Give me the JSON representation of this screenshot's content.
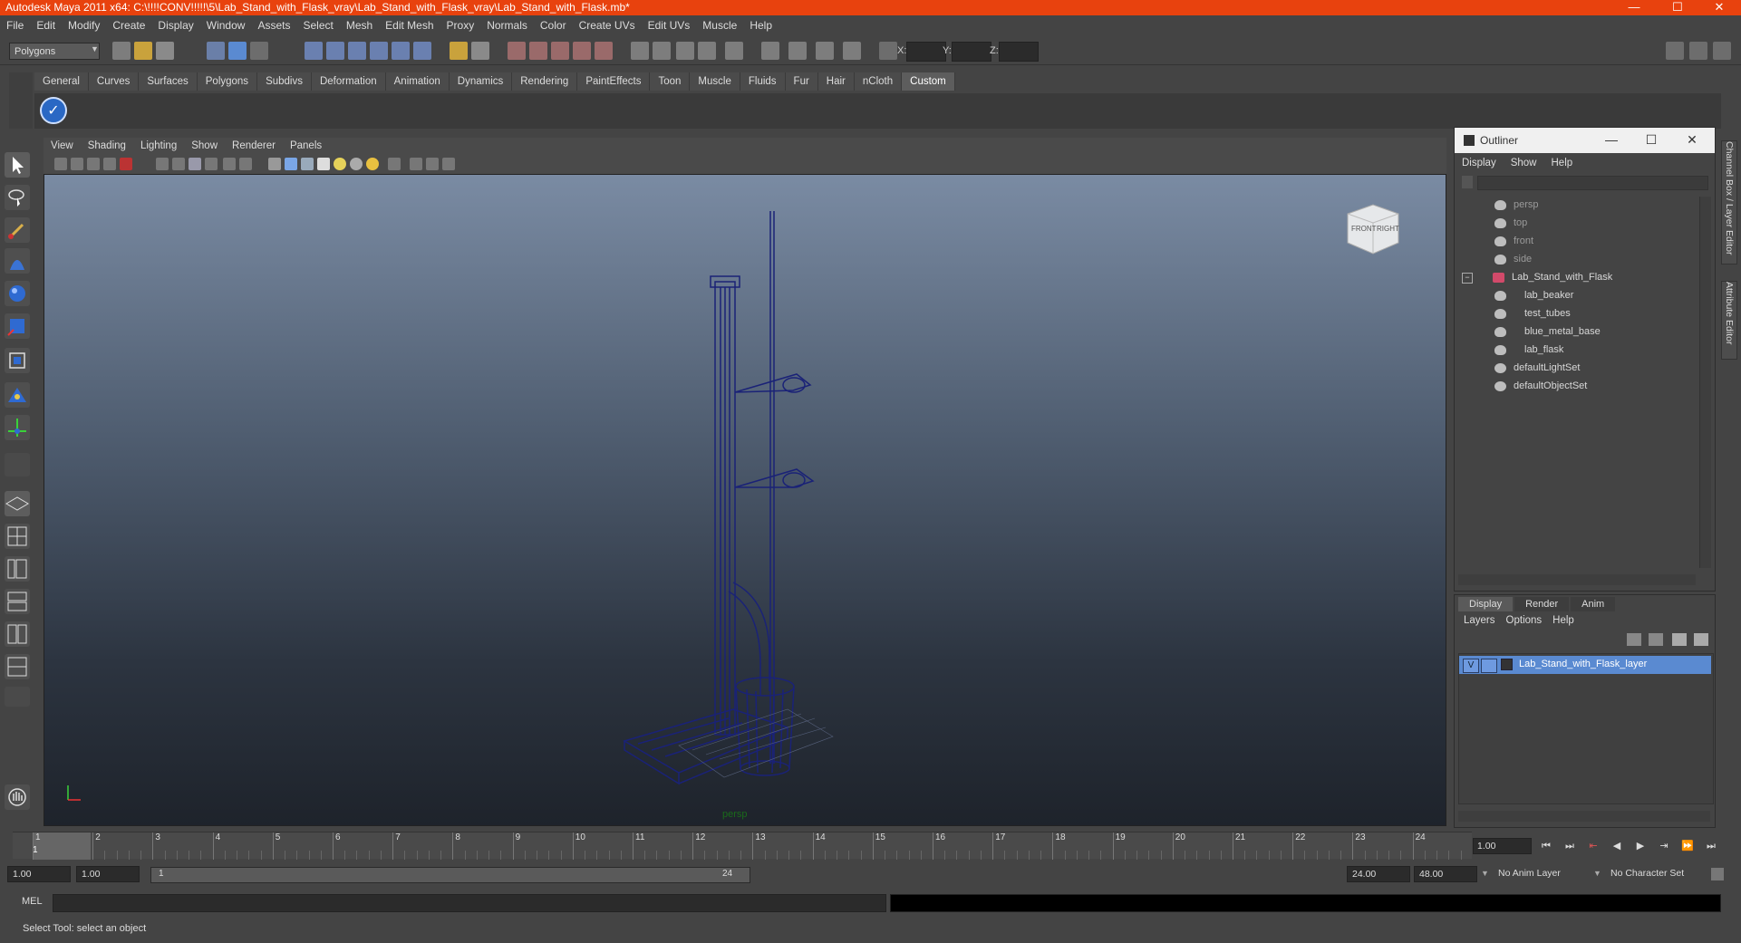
{
  "window": {
    "title": "Autodesk Maya 2011 x64: C:\\!!!!CONV!!!!!\\5\\Lab_Stand_with_Flask_vray\\Lab_Stand_with_Flask_vray\\Lab_Stand_with_Flask.mb*",
    "minimize": "—",
    "maximize": "☐",
    "close": "✕",
    "bar_color": "#e8420e"
  },
  "menubar": [
    "File",
    "Edit",
    "Modify",
    "Create",
    "Display",
    "Window",
    "Assets",
    "Select",
    "Mesh",
    "Edit Mesh",
    "Proxy",
    "Normals",
    "Color",
    "Create UVs",
    "Edit UVs",
    "Muscle",
    "Help"
  ],
  "statusline": {
    "mode": "Polygons",
    "coord_x_label": "X:",
    "coord_y_label": "Y:",
    "coord_z_label": "Z:"
  },
  "shelf": {
    "tabs": [
      "General",
      "Curves",
      "Surfaces",
      "Polygons",
      "Subdivs",
      "Deformation",
      "Animation",
      "Dynamics",
      "Rendering",
      "PaintEffects",
      "Toon",
      "Muscle",
      "Fluids",
      "Fur",
      "Hair",
      "nCloth",
      "Custom"
    ],
    "active_tab": "Custom"
  },
  "panel": {
    "menus": [
      "View",
      "Shading",
      "Lighting",
      "Show",
      "Renderer",
      "Panels"
    ],
    "camera_label": "persp",
    "viewcube_front": "FRONT",
    "viewcube_right": "RIGHT",
    "wire_color": "#1a2277"
  },
  "outliner": {
    "title": "Outliner",
    "menus": [
      "Display",
      "Show",
      "Help"
    ],
    "items": [
      {
        "label": "persp",
        "dim": true,
        "indent": 0
      },
      {
        "label": "top",
        "dim": true,
        "indent": 0
      },
      {
        "label": "front",
        "dim": true,
        "indent": 0
      },
      {
        "label": "side",
        "dim": true,
        "indent": 0
      },
      {
        "label": "Lab_Stand_with_Flask",
        "dim": false,
        "indent": 0
      },
      {
        "label": "lab_beaker",
        "dim": false,
        "indent": 1
      },
      {
        "label": "test_tubes",
        "dim": false,
        "indent": 1
      },
      {
        "label": "blue_metal_base",
        "dim": false,
        "indent": 1
      },
      {
        "label": "lab_flask",
        "dim": false,
        "indent": 1
      },
      {
        "label": "defaultLightSet",
        "dim": false,
        "indent": 0
      },
      {
        "label": "defaultObjectSet",
        "dim": false,
        "indent": 0
      }
    ],
    "collapse_symbol": "−"
  },
  "layers": {
    "tabs": [
      "Display",
      "Render",
      "Anim"
    ],
    "active_tab": "Display",
    "menus": [
      "Layers",
      "Options",
      "Help"
    ],
    "layer_name": "Lab_Stand_with_Flask_layer",
    "visibility": "V",
    "highlight_color": "#5a8ad1"
  },
  "side_tabs": [
    "Channel Box / Layer Editor",
    "Attribute Editor"
  ],
  "timeslider": {
    "ticks": [
      "1",
      "2",
      "3",
      "4",
      "5",
      "6",
      "7",
      "8",
      "9",
      "10",
      "11",
      "12",
      "13",
      "14",
      "15",
      "16",
      "17",
      "18",
      "19",
      "20",
      "21",
      "22",
      "23",
      "24"
    ],
    "current_frame": "1.00",
    "current_marker": "1"
  },
  "playback": [
    "⏮",
    "⏭",
    "⇤",
    "◀",
    "▶",
    "⇥",
    "⏩",
    "⏭"
  ],
  "range": {
    "start": "1.00",
    "current": "1.00",
    "range_start": "1",
    "range_end": "24",
    "end": "24.00",
    "max": "48.00",
    "anim_layer": "No Anim Layer",
    "char_set": "No Character Set"
  },
  "cmd": {
    "mel_label": "MEL"
  },
  "help_line": "Select Tool: select an object"
}
